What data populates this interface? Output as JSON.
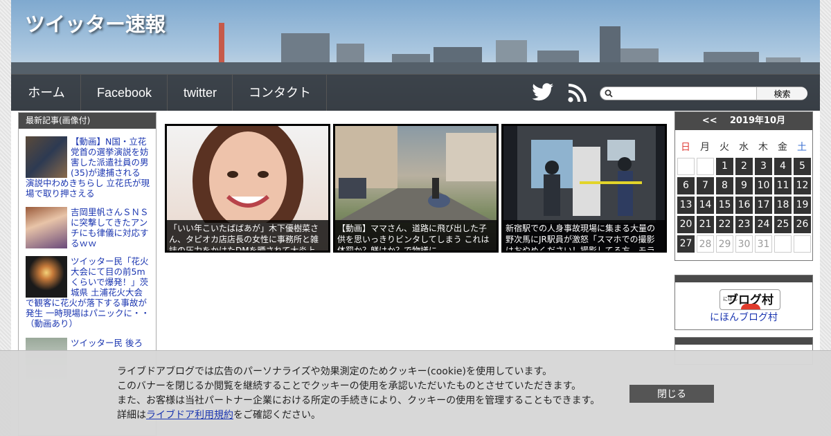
{
  "site": {
    "title": "ツイッター速報"
  },
  "nav": {
    "items": [
      "ホーム",
      "Facebook",
      "twitter",
      "コンタクト"
    ],
    "icons": [
      "twitter-bird-icon",
      "rss-icon"
    ],
    "search": {
      "placeholder": "",
      "button": "検索"
    }
  },
  "sidebar": {
    "heading": "最新記事(画像付)",
    "recent": [
      {
        "title": "【動画】N国・立花党首の選挙演説を妨害した派遣社員の男(35)が逮捕される 演説中わめきちらし 立花氏が現場で取り押さえる"
      },
      {
        "title": "吉岡里帆さんＳＮＳに突撃してきたアンチにも律儀に対応するｗｗ"
      },
      {
        "title": "ツイッター民「花火大会にて目の前5mくらいで爆発！」茨城県 土浦花火大会で観客に花火が落下する事故が発生 一時現場はパニックに・・（動画あり）"
      },
      {
        "title": "ツイッター民 後ろ"
      }
    ]
  },
  "featured": [
    {
      "caption": "「いい年こいたばばあが」木下優樹菜さん、タピオカ店店長の女性に事務所と雑誌の圧力をかけたDMを晒されて大炎上"
    },
    {
      "caption": "【動画】ママさん、道路に飛び出した子供を思いっきりビンタしてしまう これは体罰か？躾けか？で物議に"
    },
    {
      "caption": "新宿駅での人身事故現場に集まる大量の野次馬にJR駅員が激怒「スマホでの撮影はおやめください！撮影してる方、モラルは"
    }
  ],
  "calendar": {
    "prev": "<<",
    "title": "2019年10月",
    "dow": [
      "日",
      "月",
      "火",
      "水",
      "木",
      "金",
      "土"
    ],
    "weeks": [
      [
        "",
        "",
        "1",
        "2",
        "3",
        "4",
        "5"
      ],
      [
        "6",
        "7",
        "8",
        "9",
        "10",
        "11",
        "12"
      ],
      [
        "13",
        "14",
        "15",
        "16",
        "17",
        "18",
        "19"
      ],
      [
        "20",
        "21",
        "22",
        "23",
        "24",
        "25",
        "26"
      ],
      [
        "27",
        "28",
        "29",
        "30",
        "31",
        "",
        ""
      ]
    ],
    "active_through": 27,
    "sunday_color": "#e0403a",
    "saturday_color": "#3a6fd0"
  },
  "blog_ranking": {
    "logo": "ブログ村",
    "logo_small": "にほん",
    "link": "にほんブログ村"
  },
  "cookie": {
    "line1": "ライブドアブログでは広告のパーソナライズや効果測定のためクッキー(cookie)を使用しています。",
    "line2": "このバナーを閉じるか閲覧を継続することでクッキーの使用を承認いただいたものとさせていただきます。",
    "line3": "また、お客様は当社パートナー企業における所定の手続きにより、クッキーの使用を管理することもできます。",
    "line4_prefix": "詳細は",
    "line4_link": "ライブドア利用規約",
    "line4_suffix": "をご確認ください。",
    "close": "閉じる"
  }
}
